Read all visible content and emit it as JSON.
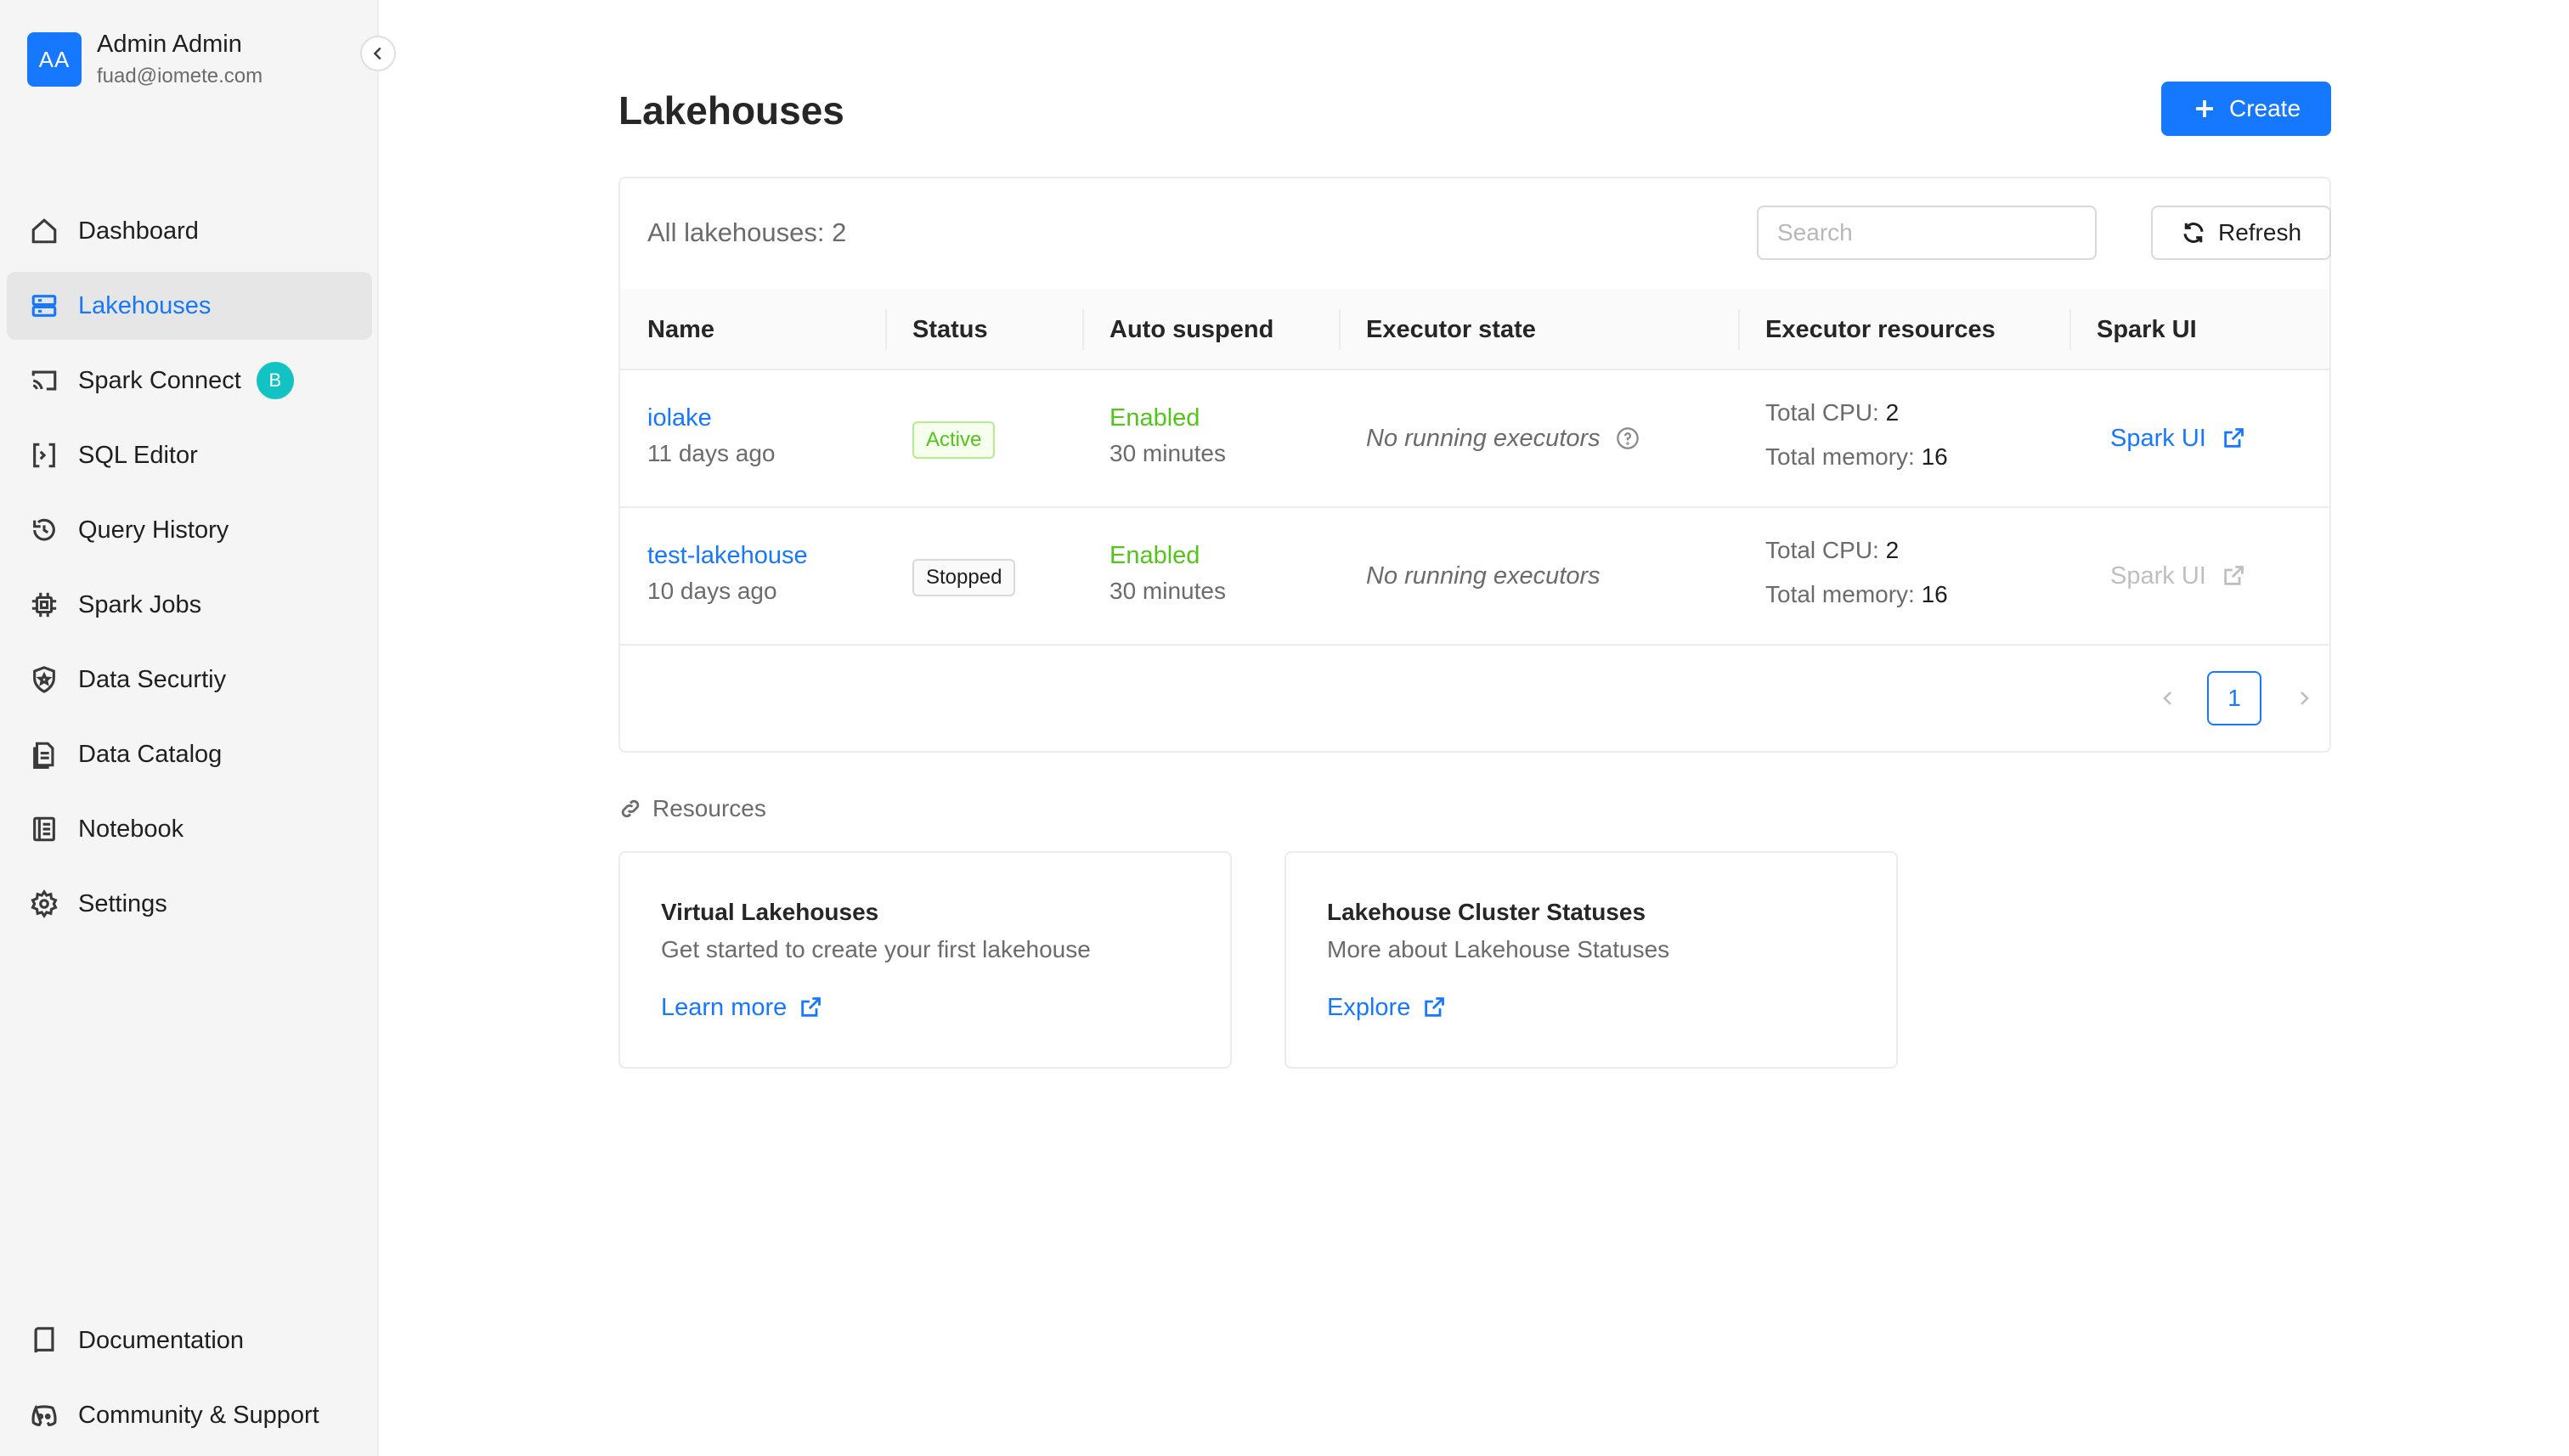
{
  "user": {
    "initials": "AA",
    "name": "Admin Admin",
    "email": "fuad@iomete.com"
  },
  "sidebar": {
    "items": [
      {
        "label": "Dashboard",
        "icon": "home-icon"
      },
      {
        "label": "Lakehouses",
        "icon": "server-icon",
        "active": true
      },
      {
        "label": "Spark Connect",
        "icon": "cast-icon",
        "badge": "B"
      },
      {
        "label": "SQL Editor",
        "icon": "sql-editor-icon"
      },
      {
        "label": "Query History",
        "icon": "history-icon"
      },
      {
        "label": "Spark Jobs",
        "icon": "chip-icon"
      },
      {
        "label": "Data Securtiy",
        "icon": "shield-star-icon"
      },
      {
        "label": "Data Catalog",
        "icon": "catalog-icon"
      },
      {
        "label": "Notebook",
        "icon": "notebook-icon"
      },
      {
        "label": "Settings",
        "icon": "gear-icon"
      }
    ],
    "bottom": [
      {
        "label": "Documentation",
        "icon": "book-icon"
      },
      {
        "label": "Community & Support",
        "icon": "discord-icon"
      }
    ]
  },
  "page": {
    "title": "Lakehouses",
    "create_label": "Create"
  },
  "table": {
    "count_label": "All lakehouses: 2",
    "search_placeholder": "Search",
    "refresh_label": "Refresh",
    "columns": [
      "Name",
      "Status",
      "Auto suspend",
      "Executor state",
      "Executor resources",
      "Spark UI"
    ],
    "rows": [
      {
        "name": "iolake",
        "age": "11 days ago",
        "status": "Active",
        "auto_suspend": "Enabled",
        "auto_suspend_time": "30 minutes",
        "executor_state": "No running executors",
        "cpu_label": "Total CPU:",
        "cpu": "2",
        "memory_label": "Total memory:",
        "memory": "16",
        "spark_ui": "Spark UI"
      },
      {
        "name": "test-lakehouse",
        "age": "10 days ago",
        "status": "Stopped",
        "auto_suspend": "Enabled",
        "auto_suspend_time": "30 minutes",
        "executor_state": "No running executors",
        "cpu_label": "Total CPU:",
        "cpu": "2",
        "memory_label": "Total memory:",
        "memory": "16",
        "spark_ui": "Spark UI"
      }
    ],
    "current_page": "1"
  },
  "resources": {
    "title": "Resources",
    "cards": [
      {
        "title": "Virtual Lakehouses",
        "description": "Get started to create your first lakehouse",
        "link": "Learn more"
      },
      {
        "title": "Lakehouse Cluster Statuses",
        "description": "More about Lakehouse Statuses",
        "link": "Explore"
      }
    ]
  },
  "colors": {
    "accent": "#1677ff",
    "success": "#52c41a",
    "beta_badge": "#13c2c2"
  }
}
